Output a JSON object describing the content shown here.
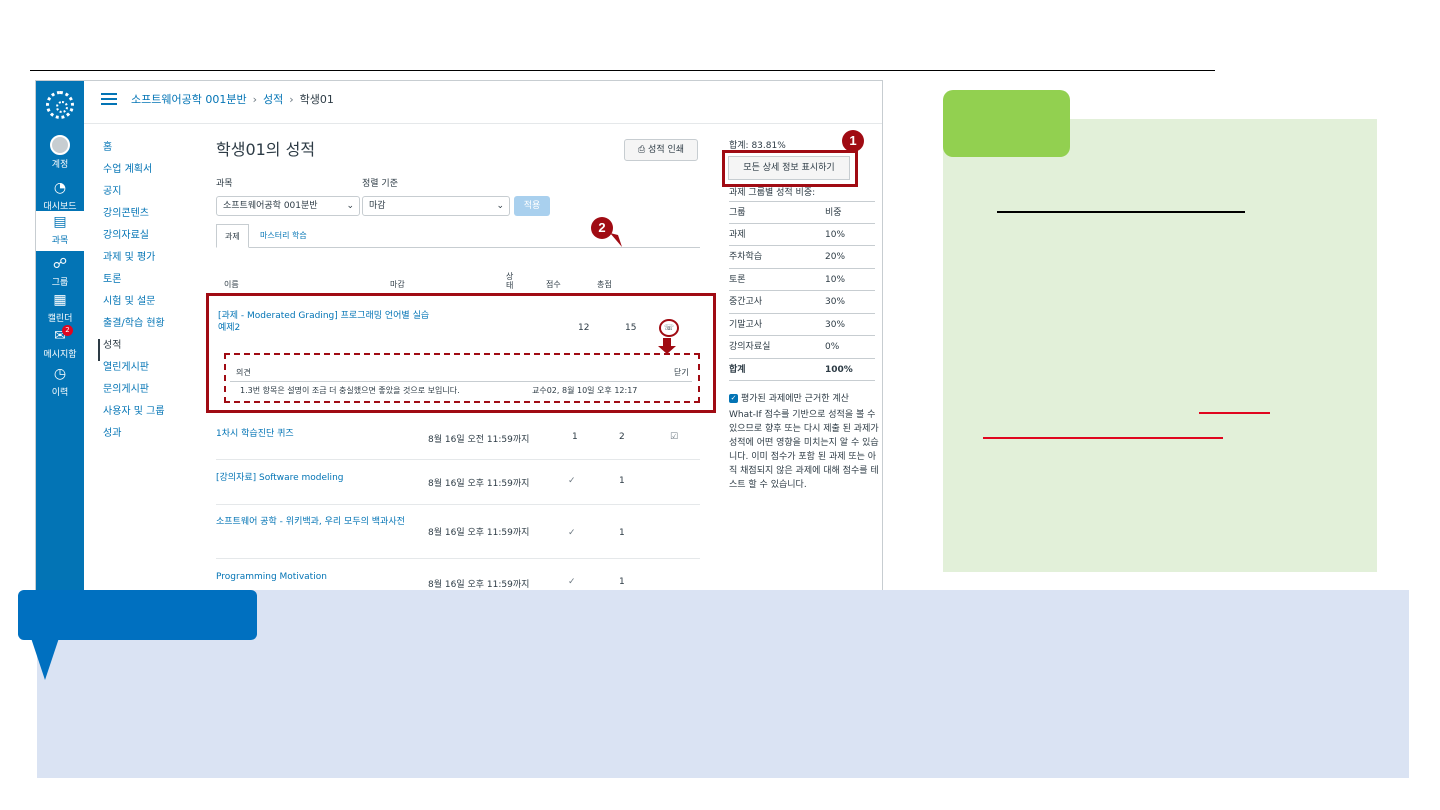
{
  "breadcrumb": {
    "course": "소프트웨어공학 001분반",
    "section": "성적",
    "current": "학생01"
  },
  "global_nav": [
    {
      "label": "계정",
      "icon": "account-icon"
    },
    {
      "label": "대시보드",
      "icon": "dashboard-icon"
    },
    {
      "label": "과목",
      "icon": "courses-icon"
    },
    {
      "label": "그룹",
      "icon": "groups-icon"
    },
    {
      "label": "캘린더",
      "icon": "calendar-icon"
    },
    {
      "label": "메시지함",
      "icon": "inbox-icon",
      "badge": "2"
    },
    {
      "label": "이력",
      "icon": "history-icon"
    }
  ],
  "course_nav": [
    "홈",
    "수업 계획서",
    "공지",
    "강의콘텐츠",
    "강의자료실",
    "과제 및 평가",
    "토론",
    "시험 및 설문",
    "출결/학습 현황",
    "성적",
    "열린게시판",
    "문의게시판",
    "사용자 및 그룹",
    "성과"
  ],
  "main": {
    "title": "학생01의 성적",
    "print_label": "성적 인쇄",
    "course_label": "과목",
    "sort_label": "정렬 기준",
    "course_value": "소프트웨어공학 001분반",
    "sort_value": "마감",
    "apply_label": "적용",
    "tabs": [
      "과제",
      "마스터리 학습"
    ],
    "headers": {
      "name": "이름",
      "due": "마감",
      "status": "상태",
      "score": "점수",
      "total": "총점"
    },
    "rows": [
      {
        "name": "[과제 - Moderated Grading] 프로그래밍 언어별 실습 예제2",
        "due": "",
        "score": "12",
        "total": "15"
      },
      {
        "name": "1차시 학습진단 퀴즈",
        "due": "8월 16일 오전 11:59까지",
        "score": "1",
        "total": "2"
      },
      {
        "name": "[강의자료] Software modeling",
        "due": "8월 16일 오후 11:59까지",
        "score": "✓",
        "total": "1"
      },
      {
        "name": "소프트웨어 공학 - 위키백과, 우리 모두의 백과사전",
        "due": "8월 16일 오후 11:59까지",
        "score": "✓",
        "total": "1"
      },
      {
        "name": "Programming Motivation",
        "due": "8월 16일 오후 11:59까지",
        "score": "✓",
        "total": "1"
      }
    ],
    "comment": {
      "heading": "의견",
      "close": "닫기",
      "text": "1.3번 항목은 설명이 조금 더 충실했으면 좋았을 것으로 보입니다.",
      "meta": "교수02, 8월 10일 오후 12:17"
    }
  },
  "side": {
    "total": "합계: 83.81%",
    "detail_btn": "모든 상세 정보 표시하기",
    "weights_title": "과제 그룹별 성적 비중:",
    "weight_headers": [
      "그룹",
      "비중"
    ],
    "weights": [
      {
        "group": "과제",
        "pct": "10%"
      },
      {
        "group": "주차학습",
        "pct": "20%"
      },
      {
        "group": "토론",
        "pct": "10%"
      },
      {
        "group": "중간고사",
        "pct": "30%"
      },
      {
        "group": "기말고사",
        "pct": "30%"
      },
      {
        "group": "강의자료실",
        "pct": "0%"
      },
      {
        "group": "합계",
        "pct": "100%"
      }
    ],
    "whatif_check": "평가된 과제에만 근거한 계산",
    "whatif_text": "What-If 점수를 기반으로 성적을 볼 수 있으므로 향후 또는 다시 제출 된 과제가 성적에 어떤 영향을 미치는지 알 수 있습니다. 이미 점수가 포함 된 과제 또는 아직 채점되지 않은 과제에 대해 점수를 테스트 할 수 있습니다."
  },
  "callouts": [
    "1",
    "2"
  ],
  "colors": {
    "accent": "#0374b5",
    "highlight": "#a00b13",
    "green_tab": "#92d050",
    "green_panel": "#e2f0d9",
    "blue_panel": "#dae3f3",
    "blue_tab": "#0070c0"
  }
}
